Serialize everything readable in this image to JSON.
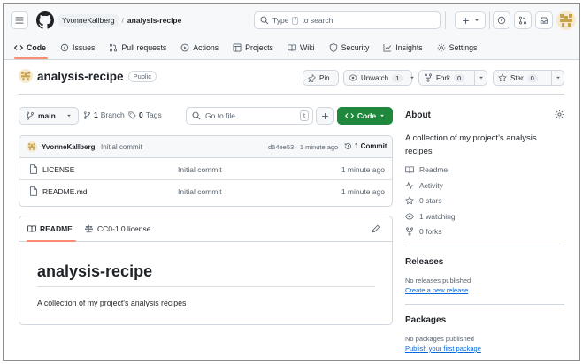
{
  "header": {
    "owner": "YvonneKallberg",
    "slash": "/",
    "repo": "analysis-recipe",
    "search_prefix": "Type",
    "search_key": "/",
    "search_suffix": "to search"
  },
  "nav_tabs": [
    {
      "label": "Code",
      "icon": "code-icon",
      "active": true
    },
    {
      "label": "Issues",
      "icon": "issue-opened-icon"
    },
    {
      "label": "Pull requests",
      "icon": "git-pull-request-icon"
    },
    {
      "label": "Actions",
      "icon": "play-icon"
    },
    {
      "label": "Projects",
      "icon": "table-icon"
    },
    {
      "label": "Wiki",
      "icon": "book-icon"
    },
    {
      "label": "Security",
      "icon": "shield-icon"
    },
    {
      "label": "Insights",
      "icon": "graph-icon"
    },
    {
      "label": "Settings",
      "icon": "gear-icon"
    }
  ],
  "repo": {
    "name": "analysis-recipe",
    "visibility": "Public",
    "pin": "Pin",
    "unwatch": "Unwatch",
    "watch_count": "1",
    "fork": "Fork",
    "fork_count": "0",
    "star": "Star",
    "star_count": "0"
  },
  "toolbar": {
    "branch": "main",
    "branches_count": "1",
    "branches_label": "Branch",
    "tags_count": "0",
    "tags_label": "Tags",
    "goto_placeholder": "Go to file",
    "goto_key": "t",
    "code_label": "Code"
  },
  "commit": {
    "author": "YvonneKallberg",
    "message": "Initial commit",
    "sha_time": "d54ee53 · 1 minute ago",
    "commits_label": "1 Commit"
  },
  "files": [
    {
      "name": "LICENSE",
      "message": "Initial commit",
      "time": "1 minute ago"
    },
    {
      "name": "README.md",
      "message": "Initial commit",
      "time": "1 minute ago"
    }
  ],
  "readme": {
    "tab_readme": "README",
    "tab_license": "CC0-1.0 license",
    "heading": "analysis-recipe",
    "body": "A collection of my project's analysis recipes"
  },
  "about": {
    "title": "About",
    "description": "A collection of my project's analysis recipes",
    "items": [
      {
        "label": "Readme",
        "icon": "book-icon"
      },
      {
        "label": "Activity",
        "icon": "pulse-icon"
      },
      {
        "label": "0 stars",
        "icon": "star-icon"
      },
      {
        "label": "1 watching",
        "icon": "eye-icon"
      },
      {
        "label": "0 forks",
        "icon": "repo-forked-icon"
      }
    ]
  },
  "releases": {
    "title": "Releases",
    "empty": "No releases published",
    "link": "Create a new release"
  },
  "packages": {
    "title": "Packages",
    "empty": "No packages published",
    "link": "Publish your first package"
  },
  "colors": {
    "accent_green": "#1f883d",
    "link_blue": "#0969da",
    "tab_underline": "#fd8c73"
  }
}
